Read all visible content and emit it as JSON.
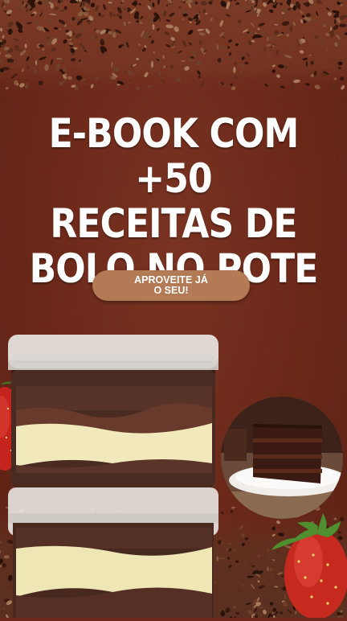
{
  "headline": {
    "line1": "E-BOOK COM +50",
    "line2": "RECEITAS DE",
    "line3": "BOLO NO POTE"
  },
  "cta": {
    "line1": "APROVEITE JÁ",
    "line2": "O SEU!"
  },
  "colors": {
    "background": "#6e2b1c",
    "cta": "#b27a55",
    "text": "#ffffff"
  },
  "images": {
    "top": "chocolate-shavings",
    "pots": "bolo-no-pote-jars",
    "slice": "chocolate-cake-slice",
    "fruit": "strawberry"
  }
}
